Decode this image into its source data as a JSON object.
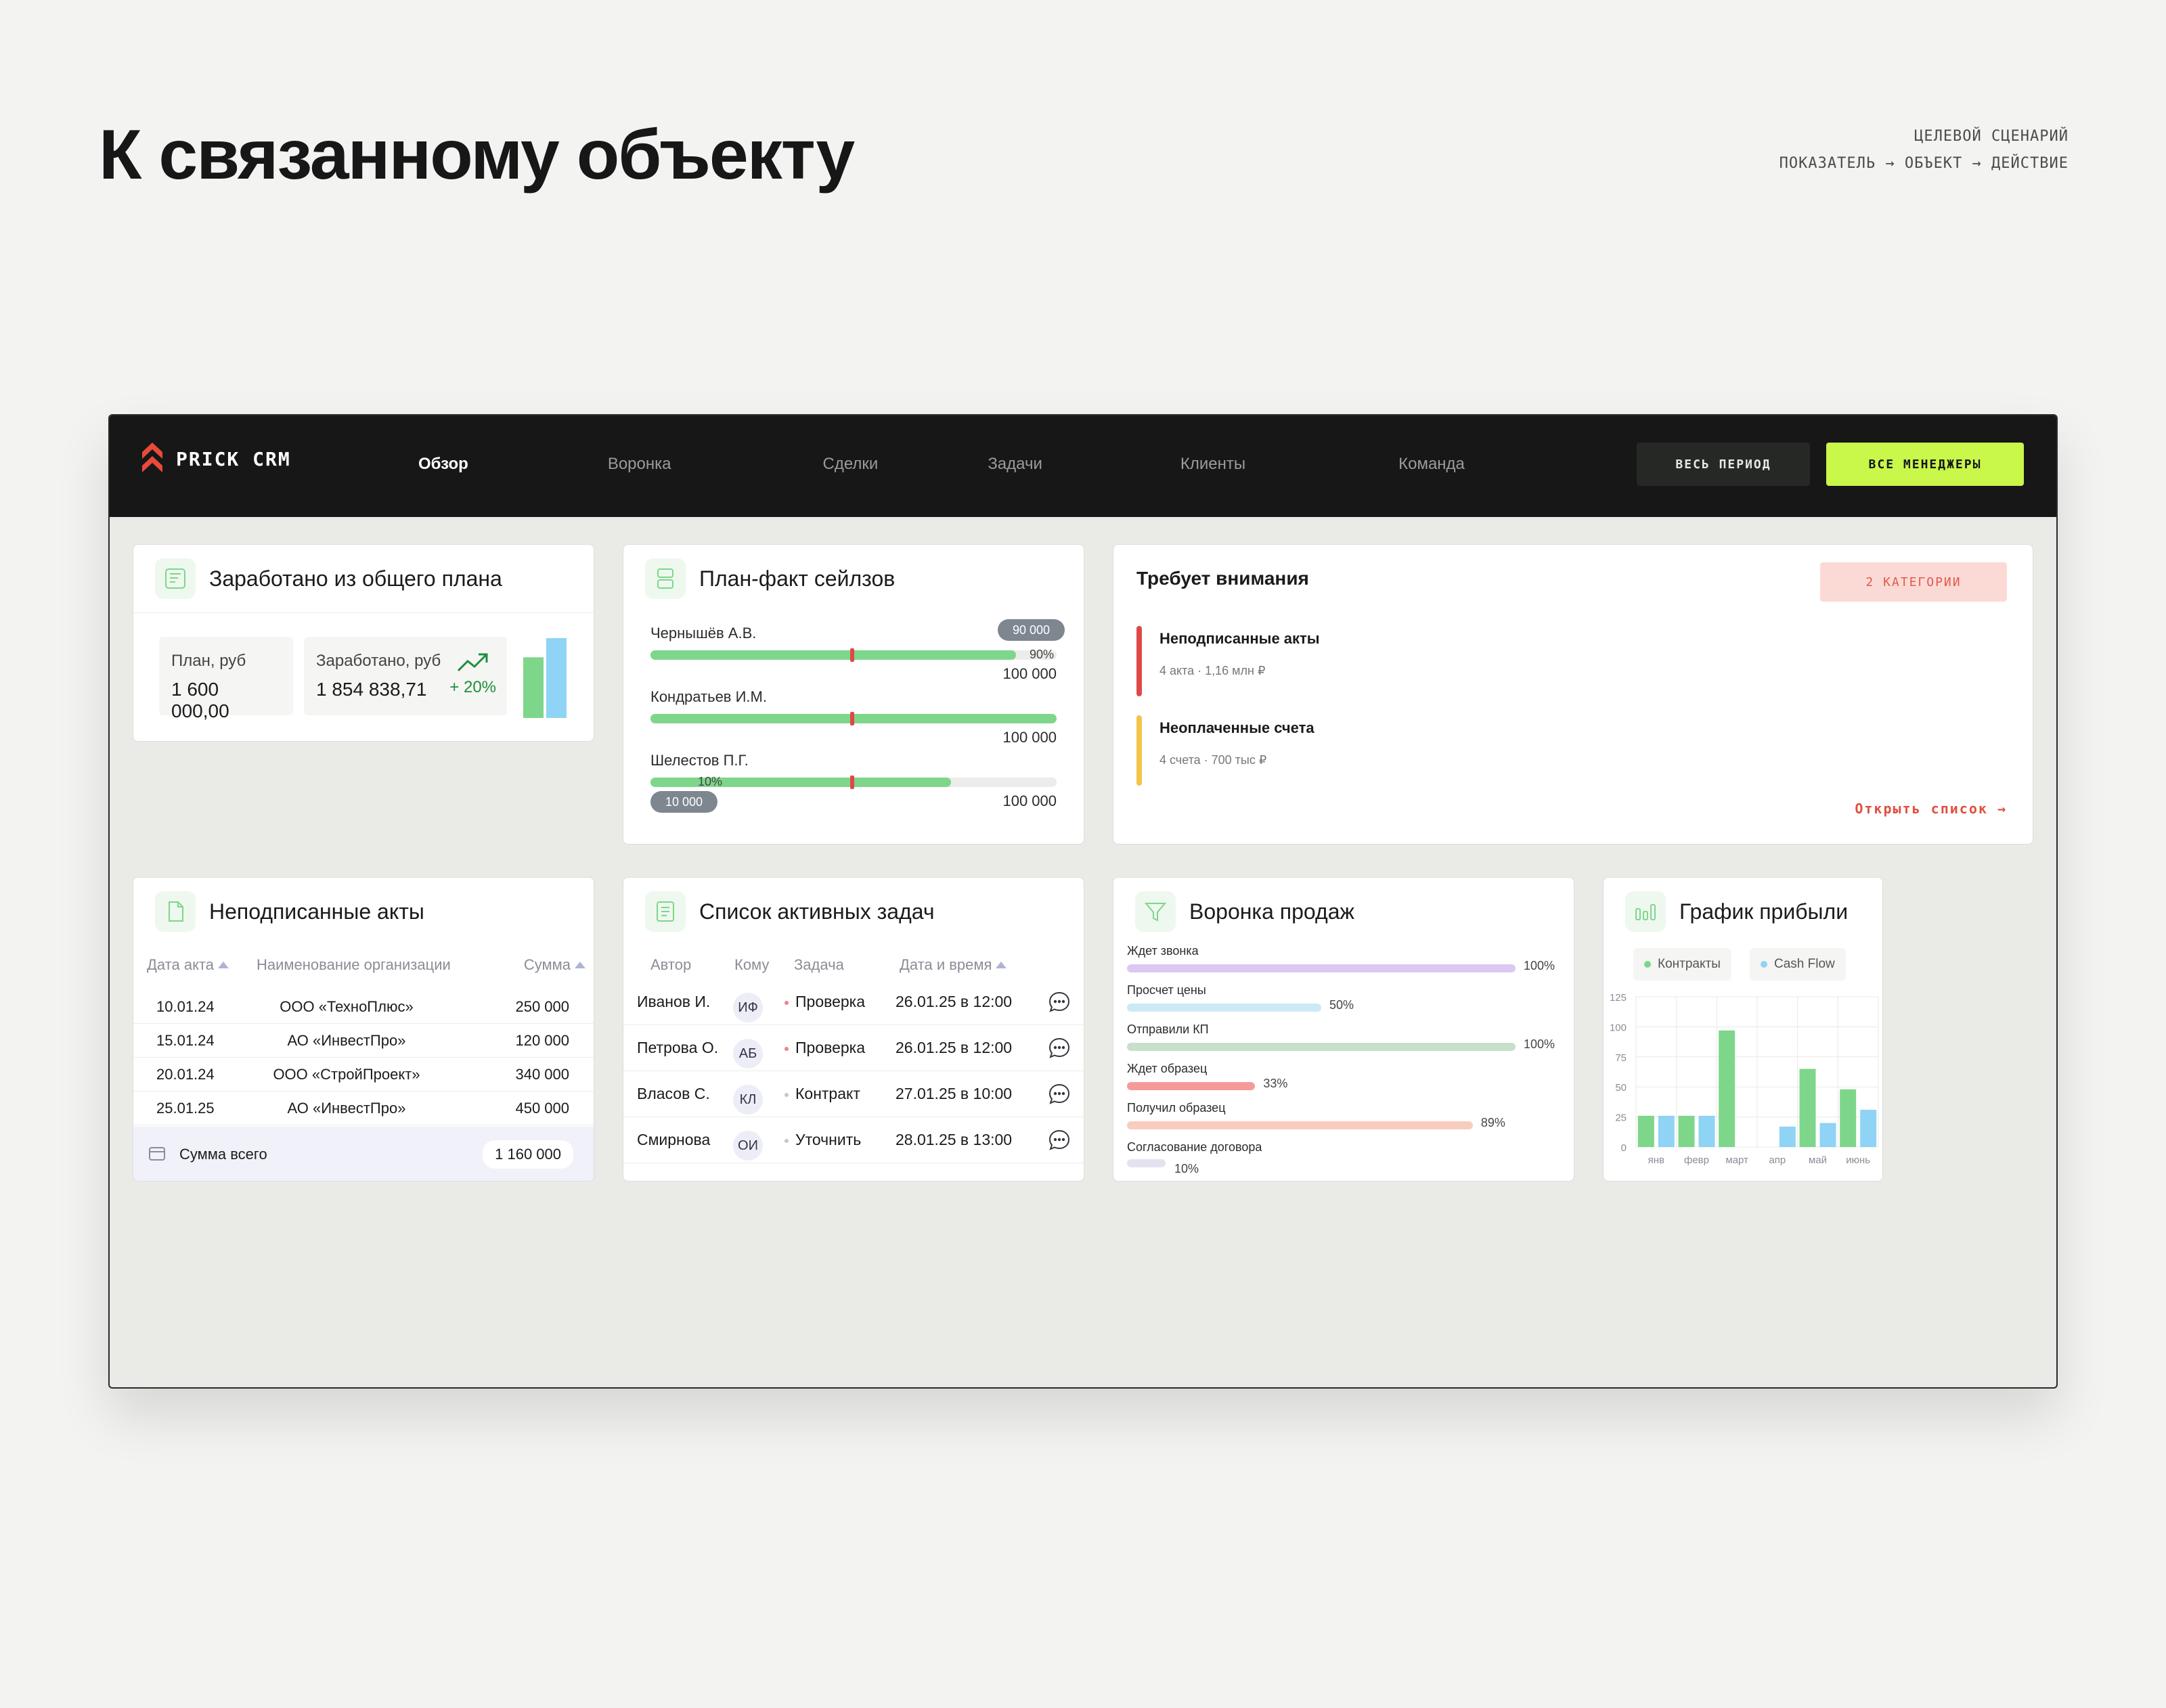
{
  "page_title": "К связанному объекту",
  "scenario": {
    "line1": "ЦЕЛЕВОЙ СЦЕНАРИЙ",
    "line2": "ПОКАЗАТЕЛЬ → ОБЪЕКТ → ДЕЙСТВИЕ"
  },
  "app": {
    "logo_text": "PRICK CRM",
    "nav": [
      "Обзор",
      "Воронка",
      "Сделки",
      "Задачи",
      "Клиенты",
      "Команда"
    ],
    "active_nav": "Обзор",
    "btn_period": "ВЕСЬ ПЕРИОД",
    "btn_managers": "ВСЕ МЕНЕДЖЕРЫ"
  },
  "earned": {
    "title": "Заработано из общего плана",
    "plan_label": "План, руб",
    "plan_value": "1 600 000,00",
    "earned_label": "Заработано, руб",
    "earned_value": "1 854 838,71",
    "growth": "+ 20%",
    "bar_plan_ratio": 0.76,
    "bar_earned_ratio": 1.0
  },
  "planfact": {
    "title": "План-факт сейлзов",
    "rows": [
      {
        "name": "Чернышёв А.В.",
        "total": "100 000",
        "progress": 0.9,
        "pct": "90%",
        "bubble": "90 000"
      },
      {
        "name": "Кондратьев И.М.",
        "total": "100 000",
        "progress": 1.0
      },
      {
        "name": "Шелестов П.Г.",
        "total": "100 000",
        "progress": 0.1,
        "pct": "10%",
        "bubble": "10 000",
        "fill_ratio": 0.74
      }
    ]
  },
  "attention": {
    "title": "Требует внимания",
    "badge": "2 КАТЕГОРИИ",
    "items": [
      {
        "title": "Неподписанные акты",
        "sub": "4 акта · 1,16 млн ₽",
        "color": "#E04848"
      },
      {
        "title": "Неоплаченные счета",
        "sub": "4 счета · 700 тыс ₽",
        "color": "#F2C54A"
      }
    ],
    "link": "Открыть список →"
  },
  "acts": {
    "title": "Неподписанные акты",
    "headers": [
      "Дата акта",
      "Наименование организации",
      "Сумма"
    ],
    "rows": [
      [
        "10.01.24",
        "ООО «ТехноПлюс»",
        "250 000"
      ],
      [
        "15.01.24",
        "АО «ИнвестПро»",
        "120 000"
      ],
      [
        "20.01.24",
        "ООО «СтройПроект»",
        "340 000"
      ],
      [
        "25.01.25",
        "АО «ИнвестПро»",
        "450 000"
      ]
    ],
    "total_label": "Сумма всего",
    "total_value": "1 160 000"
  },
  "tasks": {
    "title": "Список активных задач",
    "headers": [
      "Автор",
      "Кому",
      "Задача",
      "Дата и время"
    ],
    "rows": [
      [
        "Иванов И.",
        "ИФ",
        "Проверка",
        "26.01.25 в 12:00"
      ],
      [
        "Петрова О.",
        "АБ",
        "Проверка",
        "26.01.25 в 12:00"
      ],
      [
        "Власов С.",
        "КЛ",
        "Контракт",
        "27.01.25 в 10:00"
      ],
      [
        "Смирнова",
        "ОИ",
        "Уточнить",
        "28.01.25 в 13:00"
      ]
    ]
  },
  "funnel": {
    "title": "Воронка продаж",
    "stages": [
      {
        "label": "Ждет звонка",
        "pct": "100%",
        "value": 1.0,
        "color": "#DCC8F2"
      },
      {
        "label": "Просчет цены",
        "pct": "50%",
        "value": 0.5,
        "color": "#CBEAF5"
      },
      {
        "label": "Отправили КП",
        "pct": "100%",
        "value": 1.0,
        "color": "#C8DFCB"
      },
      {
        "label": "Ждет образец",
        "pct": "33%",
        "value": 0.33,
        "color": "#F59A9A"
      },
      {
        "label": "Получил образец",
        "pct": "89%",
        "value": 0.89,
        "color": "#F9CDBE"
      },
      {
        "label": "Согласование договора",
        "pct": "10%",
        "value": 0.1,
        "color": "#E2E2F0"
      }
    ]
  },
  "profit": {
    "title": "График прибыли",
    "legend": [
      "Контракты",
      "Cash Flow"
    ]
  },
  "colors": {
    "accent": "#C9F74A",
    "bar_green": "#7ED68A",
    "bar_blue": "#8FD3F5",
    "danger": "#E04848"
  },
  "chart_data": {
    "type": "bar",
    "categories": [
      "янв",
      "февр",
      "март",
      "апр",
      "май",
      "июнь"
    ],
    "series": [
      {
        "name": "Контракты",
        "values": [
          26,
          26,
          97,
          0,
          65,
          48
        ]
      },
      {
        "name": "Cash Flow",
        "values": [
          26,
          26,
          0,
          17,
          20,
          31
        ]
      }
    ],
    "ylim": [
      0,
      125
    ],
    "yticks": [
      "125",
      "100",
      "75",
      "50",
      "25",
      "0"
    ],
    "grid": true
  }
}
